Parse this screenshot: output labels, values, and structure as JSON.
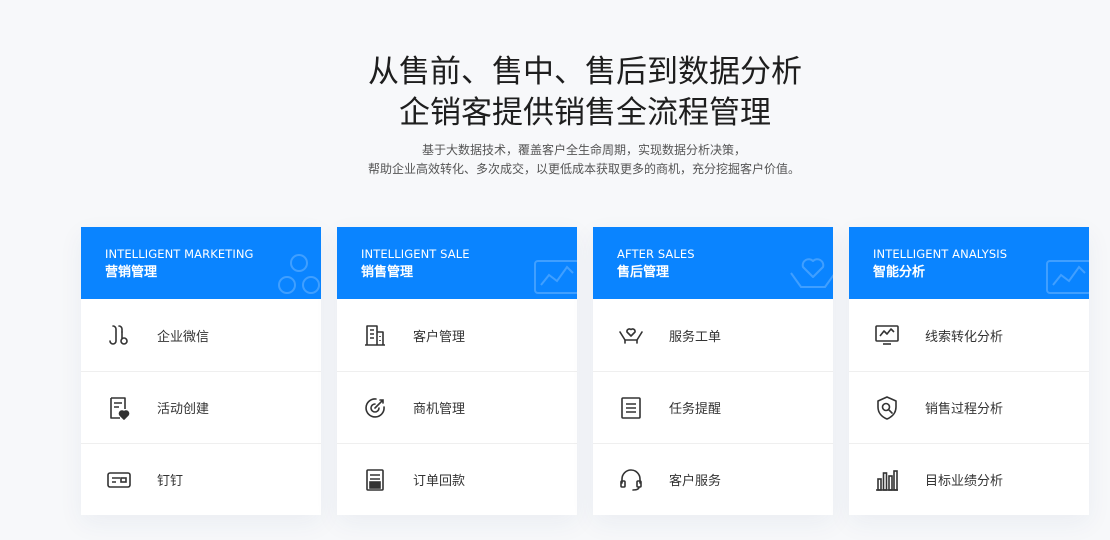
{
  "header": {
    "title_line1": "从售前、售中、售后到数据分析",
    "title_line2": "企销客提供销售全流程管理",
    "subtitle_line1": "基于大数据技术，覆盖客户全生命周期，实现数据分析决策，",
    "subtitle_line2": "帮助企业高效转化、多次成交，以更低成本获取更多的商机，充分挖掘客户价值。"
  },
  "colors": {
    "accent": "#0a84ff",
    "background": "#f7f8fa"
  },
  "cards": [
    {
      "en": "INTELLIGENT MARKETING",
      "cn": "营销管理",
      "items": [
        {
          "label": "企业微信",
          "icon": "wechat-work-icon"
        },
        {
          "label": "活动创建",
          "icon": "activity-create-icon"
        },
        {
          "label": "钉钉",
          "icon": "dingtalk-icon"
        }
      ]
    },
    {
      "en": "INTELLIGENT SALE",
      "cn": "销售管理",
      "items": [
        {
          "label": "客户管理",
          "icon": "building-icon"
        },
        {
          "label": "商机管理",
          "icon": "target-icon"
        },
        {
          "label": "订单回款",
          "icon": "receipt-icon"
        }
      ]
    },
    {
      "en": "AFTER SALES",
      "cn": "售后管理",
      "items": [
        {
          "label": "服务工单",
          "icon": "hands-heart-icon"
        },
        {
          "label": "任务提醒",
          "icon": "task-list-icon"
        },
        {
          "label": "客户服务",
          "icon": "headset-icon"
        }
      ]
    },
    {
      "en": "INTELLIGENT ANALYSIS",
      "cn": "智能分析",
      "items": [
        {
          "label": "线索转化分析",
          "icon": "monitor-chart-icon"
        },
        {
          "label": "销售过程分析",
          "icon": "shield-search-icon"
        },
        {
          "label": "目标业绩分析",
          "icon": "bar-chart-icon"
        }
      ]
    }
  ]
}
